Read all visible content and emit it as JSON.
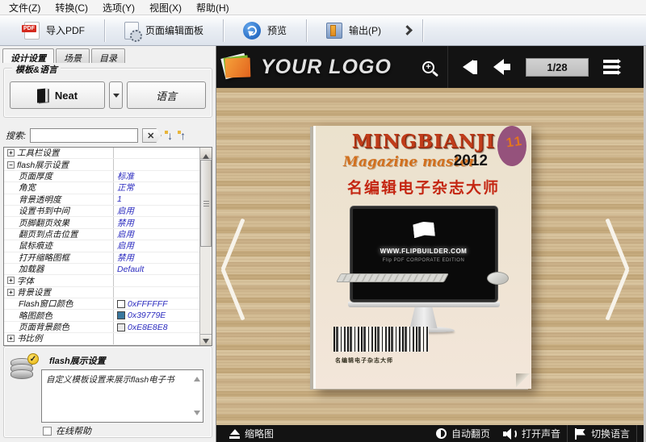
{
  "menu": {
    "items": [
      {
        "label": "文件(Z)"
      },
      {
        "label": "转换(C)"
      },
      {
        "label": "选项(Y)"
      },
      {
        "label": "视图(X)"
      },
      {
        "label": "帮助(H)"
      }
    ]
  },
  "toolbar": {
    "items": [
      {
        "name": "import-pdf",
        "label": "导入PDF"
      },
      {
        "name": "page-edit-panel",
        "label": "页面编辑面板"
      },
      {
        "name": "preview",
        "label": "预览"
      },
      {
        "name": "output",
        "label": "输出(P)"
      }
    ]
  },
  "panel": {
    "tabs": [
      {
        "label": "设计设置",
        "active": true
      },
      {
        "label": "场景",
        "active": false
      },
      {
        "label": "目录",
        "active": false
      }
    ],
    "template_group": {
      "title": "模板&语言",
      "template_button": "Neat",
      "language_button": "语言"
    },
    "search": {
      "label": "搜索:",
      "value": "",
      "clear_glyph": "✕",
      "collapse_glyph": "↓",
      "expand_glyph": "↑"
    },
    "settings": {
      "value_color": "#2b2bbf",
      "rows": [
        {
          "label": "工具栏设置",
          "value": "",
          "expand": "+",
          "level": 0
        },
        {
          "label": "flash展示设置",
          "value": "",
          "expand": "-",
          "level": 0
        },
        {
          "label": "页面厚度",
          "value": "标准",
          "level": 1
        },
        {
          "label": "角宽",
          "value": "正常",
          "level": 1
        },
        {
          "label": "背景透明度",
          "value": "1",
          "level": 1
        },
        {
          "label": "设置书到中间",
          "value": "启用",
          "level": 1
        },
        {
          "label": "页脚翻页效果",
          "value": "禁用",
          "level": 1
        },
        {
          "label": "翻页到点击位置",
          "value": "启用",
          "level": 1
        },
        {
          "label": "鼠标痕迹",
          "value": "启用",
          "level": 1
        },
        {
          "label": "打开缩略图框",
          "value": "禁用",
          "level": 1
        },
        {
          "label": "加载器",
          "value": "Default",
          "level": 1
        },
        {
          "label": "字体",
          "value": "",
          "expand": "+",
          "level": 0
        },
        {
          "label": "背景设置",
          "value": "",
          "expand": "+",
          "level": 0
        },
        {
          "label": "Flash窗口颜色",
          "value": "0xFFFFFF",
          "swatch": "#FFFFFF",
          "level": 1
        },
        {
          "label": "略图颜色",
          "value": "0x39779E",
          "swatch": "#39779E",
          "level": 1
        },
        {
          "label": "页面背景颜色",
          "value": "0xE8E8E8",
          "swatch": "#E8E8E8",
          "level": 1
        },
        {
          "label": "书比例",
          "value": "",
          "expand": "+",
          "level": 0
        }
      ]
    },
    "info": {
      "title": "flash展示设置",
      "description": "自定义模板设置来展示flash电子书",
      "online_help": "在线帮助",
      "badge_glyph": "✓"
    }
  },
  "viewer": {
    "logo_text": "YOUR LOGO",
    "page_indicator": "1/28",
    "zoom_glyph": "+",
    "cover": {
      "title_en": "MINGBIANJI",
      "subtitle": "Magazine master",
      "year": "2012",
      "issue": "11",
      "title_cn": "名编辑电子杂志大师",
      "screen_site": "WWW.FLIPBUILDER.COM",
      "screen_edition": "Flip PDF CORPORATE EDITION",
      "barcode_caption": "名编辑电子杂志大师"
    },
    "bottom": {
      "thumbnail": "缩略图",
      "autoflip": "自动翻页",
      "sound": "打开声音",
      "language": "切换语言"
    },
    "colors": {
      "icon_color": "#39779E",
      "page_bg": "#E8E8E8",
      "flash_window": "#FFFFFF"
    }
  }
}
